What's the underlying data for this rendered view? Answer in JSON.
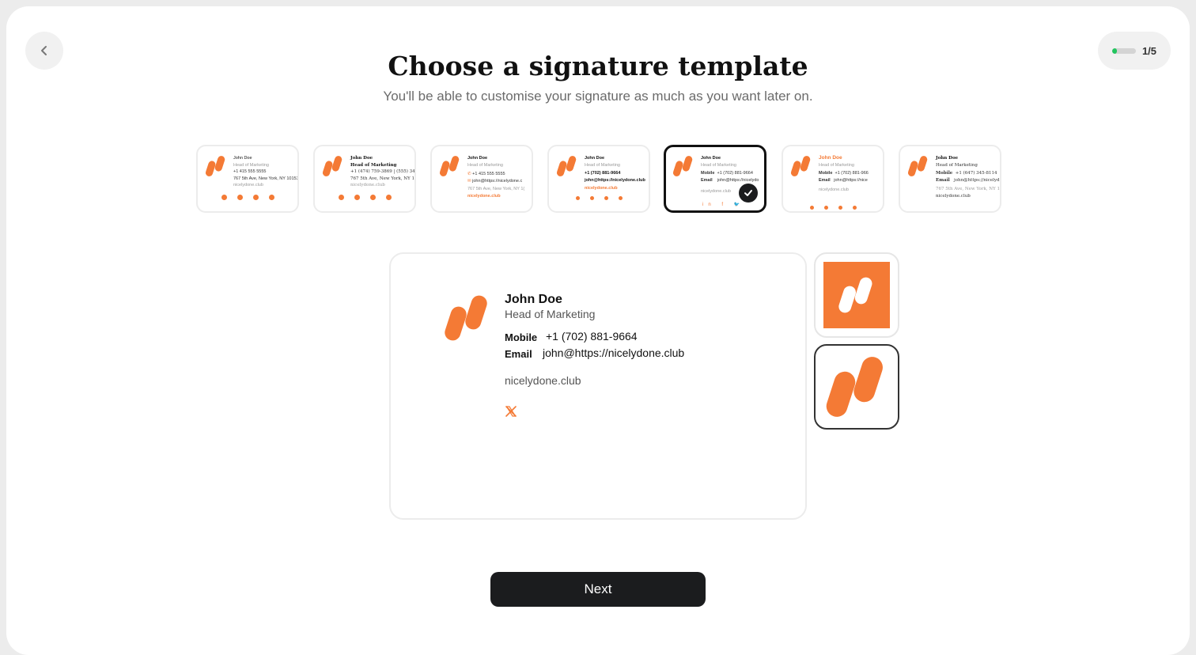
{
  "header": {
    "title": "Choose a signature template",
    "subtitle": "You'll be able to customise your signature as much as you want later on."
  },
  "progress": {
    "label": "1/5",
    "fraction": 0.2,
    "color": "#22c55e"
  },
  "colors": {
    "accent": "#f47a35",
    "dark": "#1b1c1e"
  },
  "templates": [
    {
      "name": "John Doe",
      "role": "Head of Marketing",
      "phone": "+1 415 555 5555",
      "address": "767 5th Ave, New York, NY 10153",
      "website": "nicelydone.club"
    },
    {
      "name": "John Doe",
      "role": "Head of Marketing",
      "phone": "+1 (474) 759-3869 | (555) 346-7",
      "address": "767 5th Ave, New York, NY 1015",
      "website": "nicelydone.club"
    },
    {
      "name": "John Doe",
      "role": "Head of Marketing",
      "phone": "+1 415 555 5555",
      "email": "john@https://nicelydone.c",
      "address": "767 5th Ave, New York, NY 1(",
      "website": "nicelydone.club"
    },
    {
      "name": "John Doe",
      "role": "Head of Marketing",
      "phone": "+1 (702) 881-9664",
      "email": "john@https://nicelydone.club",
      "website": "nicelydone.club"
    },
    {
      "name": "John Doe",
      "role": "Head of Marketing",
      "mobile_label": "Mobile",
      "phone": "+1 (702) 881-9664",
      "email_label": "Email",
      "email": "john@https://nicelydo",
      "website": "nicelydone.club",
      "selected": true
    },
    {
      "name": "John Doe",
      "role": "Head of Marketing",
      "mobile_label": "Mobile",
      "phone": "+1 (702) 881-966",
      "email_label": "Email",
      "email": "john@https://nice",
      "website": "nicelydone.club"
    },
    {
      "name": "John Doe",
      "role": "Head of Marketing",
      "mobile_label": "Mobile",
      "phone": "+1 (647) 345-8114",
      "email_label": "Email",
      "email": "john@https://nicelyd",
      "address": "767 5th Ave, New York, NY 1c",
      "website": "nicelydone.club"
    }
  ],
  "preview": {
    "name": "John Doe",
    "role": "Head of Marketing",
    "mobile_label": "Mobile",
    "mobile": "+1 (702) 881-9664",
    "email_label": "Email",
    "email": "john@https://nicelydone.club",
    "website": "nicelydone.club",
    "social_icon": "x-twitter-icon"
  },
  "logo_options": [
    "logo-on-orange-square",
    "logo-orange-plain"
  ],
  "footer": {
    "next_label": "Next"
  }
}
